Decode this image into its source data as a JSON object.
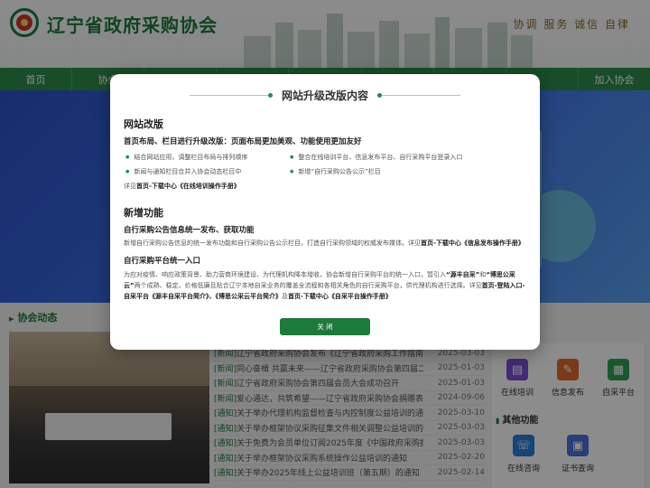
{
  "header": {
    "site_name": "辽宁省政府采购协会",
    "slogan": "协调 服务 诚信 自律"
  },
  "nav": {
    "items": [
      "首页",
      "协会",
      "",
      "",
      "",
      "",
      "",
      "",
      "加入协会"
    ]
  },
  "content": {
    "section_title": "协会动态",
    "news": [
      {
        "tag": "[新闻]",
        "title": "辽宁省政府采购协会发布《辽宁省政府采购工作指南——采购人",
        "date": "2025-03-03"
      },
      {
        "tag": "[新闻]",
        "title": "同心奋楫 共赢未来——辽宁省政府采购协会第四届二次会员大会",
        "date": "2025-01-03"
      },
      {
        "tag": "[新闻]",
        "title": "辽宁省政府采购协会第四届会员大会成功召开",
        "date": "2025-01-03"
      },
      {
        "tag": "[新闻]",
        "title": "爱心通达，共筑希望——辽宁省政府采购协会捐赠表扬抗洪救灾",
        "date": "2024-09-06"
      },
      {
        "tag": "[通知]",
        "title": "关于举办代理机构监督检查与内控制度公益培训的通知",
        "date": "2025-03-10"
      },
      {
        "tag": "[通知]",
        "title": "关于举办框架协议采购征集文件相关调整公益培训的通知",
        "date": "2025-03-03"
      },
      {
        "tag": "[通知]",
        "title": "关于免费为会员单位订阅2025年度《中国政府采购报》的通知",
        "date": "2025-03-03"
      },
      {
        "tag": "[通知]",
        "title": "关于举办框架协议采购系统操作公益培训的通知",
        "date": "2025-02-20"
      },
      {
        "tag": "[通知]",
        "title": "关于举办2025年线上公益培训班（第五期）的通知",
        "date": "2025-02-14"
      }
    ],
    "tiles": [
      {
        "label": "在线培训",
        "color": "#7b4fd6"
      },
      {
        "label": "信息发布",
        "color": "#e06a2a"
      },
      {
        "label": "自采平台",
        "color": "#2ea153"
      }
    ],
    "other_title": "其他功能",
    "tiles2": [
      {
        "label": "在线咨询",
        "color": "#2a7fd6"
      },
      {
        "label": "证书查询",
        "color": "#4c6fd8"
      }
    ]
  },
  "modal": {
    "title": "网站升级改版内容",
    "s1_title": "网站改版",
    "s1_sub": "首页布局、栏目进行升级改版：页面布局更加美观、功能使用更加友好",
    "bullets": [
      "结合网站应用，调整栏目布局与排列顺序",
      "整合在线培训平台、信息发布平台、自行采购平台登录入口",
      "新闻与通知栏目合并入协会动态栏目中",
      "新增“自行采购公告公示”栏目"
    ],
    "s1_note_pre": "详见",
    "s1_note_link": "首页-下载中心《在线培训操作手册》",
    "s2_title": "新增功能",
    "f1_title": "自行采购公告信息统一发布、获取功能",
    "f1_text": "新增自行采购公告信息的统一发布功能和自行采购公告公示栏目，打造自行采购领域的权威发布媒体。详见",
    "f1_link": "首页-下载中心《信息发布操作手册》",
    "f2_title": "自行采购平台统一入口",
    "f2_text1": "为应对疫情、响应政策背景、助力营商环境建设、为代理机构降本增收，协会新增自行采购平台的统一入口，暂引入",
    "f2_b1": "“源丰自采”",
    "f2_text2": "和",
    "f2_b2": "“博思公采云”",
    "f2_text3": "两个成熟、稳定、价格低廉且贴合辽宁本地自采业务的覆盖全流程和各相关角色的自行采购平台，供代理机构进行选择。详见",
    "f2_link1": "首页-登陆入口-自采平台《源丰自采平台简介》、《博思公采云平台简介》",
    "f2_text4": "及",
    "f2_link2": "首页-下载中心《自采平台操作手册》",
    "close_label": "关 闭"
  }
}
